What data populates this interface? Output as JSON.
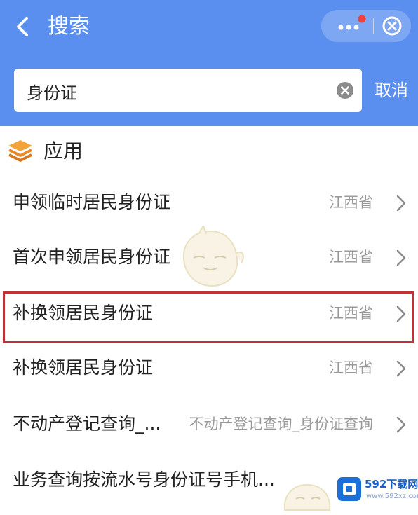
{
  "header": {
    "title": "搜索",
    "colors": {
      "background": "#5a8ff0",
      "text": "#ffffff"
    }
  },
  "search": {
    "value": "身份证",
    "cancel_label": "取消"
  },
  "section": {
    "label": "应用"
  },
  "results": [
    {
      "name": "申领临时居民身份证",
      "region": "江西省"
    },
    {
      "name": "首次申领居民身份证",
      "region": "江西省"
    },
    {
      "name": "补换领居民身份证",
      "region": "江西省",
      "highlighted": true
    },
    {
      "name": "补换领居民身份证",
      "region": "江西省"
    },
    {
      "name": "不动产登记查询_...",
      "region": "不动产登记查询_身份证查询"
    },
    {
      "name": "业务查询按流水号身份证号手机...",
      "region": ""
    }
  ],
  "watermark": {
    "brand": "592下载网",
    "url": "www.592xz.com"
  },
  "highlight_color": "#c0323a"
}
